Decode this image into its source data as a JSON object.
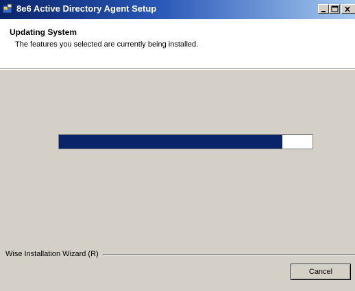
{
  "window": {
    "title": "8e6 Active Directory Agent Setup",
    "controls": [
      "minimize",
      "maximize",
      "close"
    ]
  },
  "header": {
    "title": "Updating System",
    "subtitle": "The features you selected are currently being installed."
  },
  "progress": {
    "percent": 88
  },
  "footer": {
    "brand": "Wise Installation Wizard (R)",
    "cancel_label": "Cancel"
  },
  "colors": {
    "titlebar_start": "#0a246a",
    "titlebar_end": "#a6caf0",
    "progress_fill": "#0a246a",
    "face": "#d4d0c8"
  }
}
